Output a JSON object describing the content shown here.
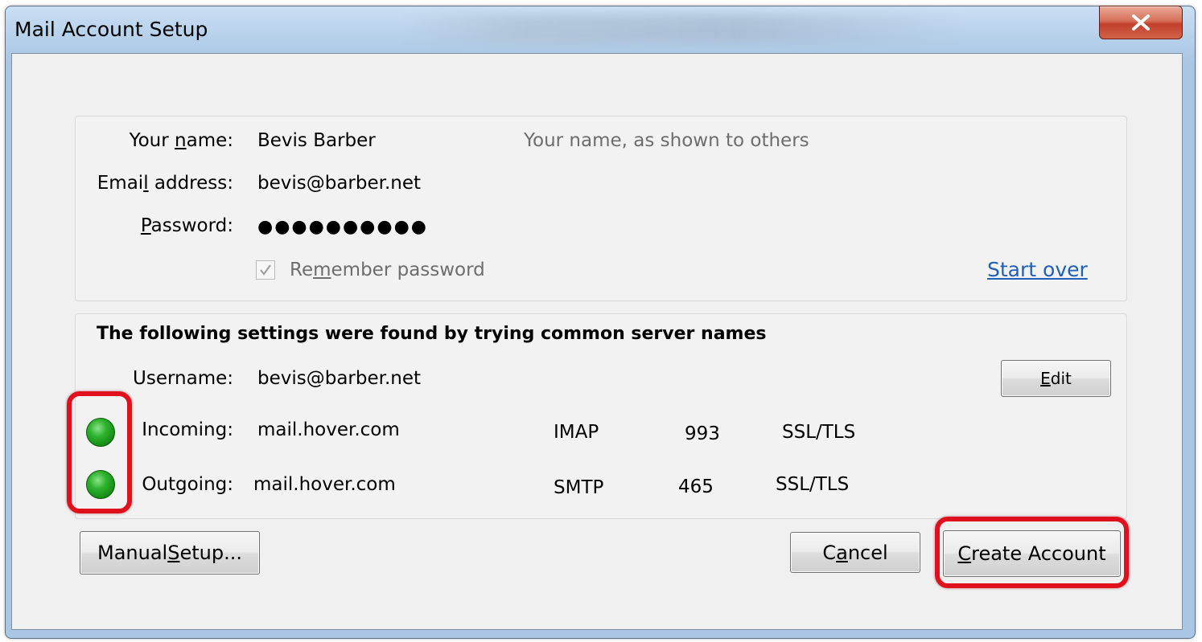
{
  "window": {
    "title": "Mail Account Setup",
    "close_glyph": "✕"
  },
  "account": {
    "name_label_pre": "Your ",
    "name_label_u": "n",
    "name_label_post": "ame:",
    "name_value": "Bevis Barber",
    "name_hint": "Your name, as shown to others",
    "email_label_pre": "Emai",
    "email_label_u": "l",
    "email_label_post": " address:",
    "email_value": "bevis@barber.net",
    "password_label_u": "P",
    "password_label_post": "assword:",
    "password_value": "●●●●●●●●●●",
    "remember_checked": true,
    "remember_label_pre": "Re",
    "remember_label_u": "m",
    "remember_label_post": "ember password",
    "start_over_link": "Start over"
  },
  "settings": {
    "heading": "The following settings were found by trying common server names",
    "username_label": "Username:",
    "username_value": "bevis@barber.net",
    "edit_label_u": "E",
    "edit_label_post": "dit",
    "incoming": {
      "label": "Incoming:",
      "server": "mail.hover.com",
      "protocol": "IMAP",
      "port": "993",
      "security": "SSL/TLS",
      "status_color": "#2fb32f"
    },
    "outgoing": {
      "label": "Outgoing:",
      "server": "mail.hover.com",
      "protocol": "SMTP",
      "port": "465",
      "security": "SSL/TLS",
      "status_color": "#2fb32f"
    }
  },
  "footer": {
    "manual_setup_pre": "Manual ",
    "manual_setup_u": "S",
    "manual_setup_post": "etup...",
    "cancel_pre": "C",
    "cancel_u": "a",
    "cancel_post": "ncel",
    "create_u": "C",
    "create_post": "reate Account"
  },
  "colors": {
    "highlight": "#e0101c",
    "link": "#1f5fb8"
  }
}
